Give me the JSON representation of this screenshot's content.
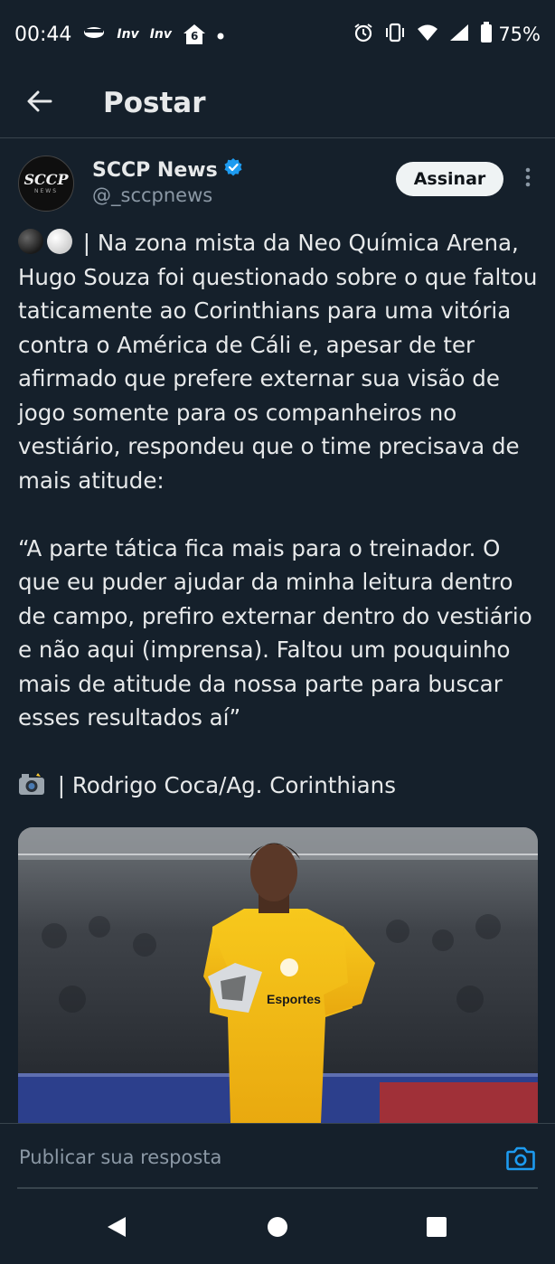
{
  "status_bar": {
    "time": "00:44",
    "small_label_1": "Inv",
    "small_label_2": "Inv",
    "badge_number": "6",
    "battery": "75%",
    "icons": [
      "alarm-icon",
      "vibrate-icon",
      "wifi-icon",
      "signal-icon",
      "battery-icon"
    ]
  },
  "header": {
    "title": "Postar",
    "back_icon": "arrow-left-icon"
  },
  "post": {
    "author_name": "SCCP News",
    "author_handle": "@_sccpnews",
    "verified": true,
    "avatar_text": "SCCP",
    "avatar_subtext": "NEWS",
    "subscribe_label": "Assinar",
    "paragraph_1": " | Na zona mista da Neo Química Arena, Hugo Souza foi questionado sobre o que faltou taticamente ao Corinthians para uma vitória contra o América de Cáli e, apesar de ter afirmado que prefere externar sua visão de jogo somente para os companheiros no vestiário, respondeu que o time precisava de mais atitude:",
    "paragraph_2": "“A parte tática fica mais para o treinador. O que eu puder ajudar da minha leitura dentro de campo, prefiro externar dentro do vestiário e não aqui (imprensa). Faltou um pouquinho mais de atitude da nossa parte para buscar esses resultados aí”",
    "paragraph_3": " | Rodrigo Coca/Ag. Corinthians",
    "image_jersey_text": "Esportes"
  },
  "reply": {
    "placeholder": "Publicar sua resposta",
    "camera_icon": "camera-icon"
  },
  "colors": {
    "background": "#15202b",
    "text": "#e7e9ea",
    "muted": "#8b98a5",
    "accent": "#1d9bf0",
    "divider": "#38444d"
  }
}
